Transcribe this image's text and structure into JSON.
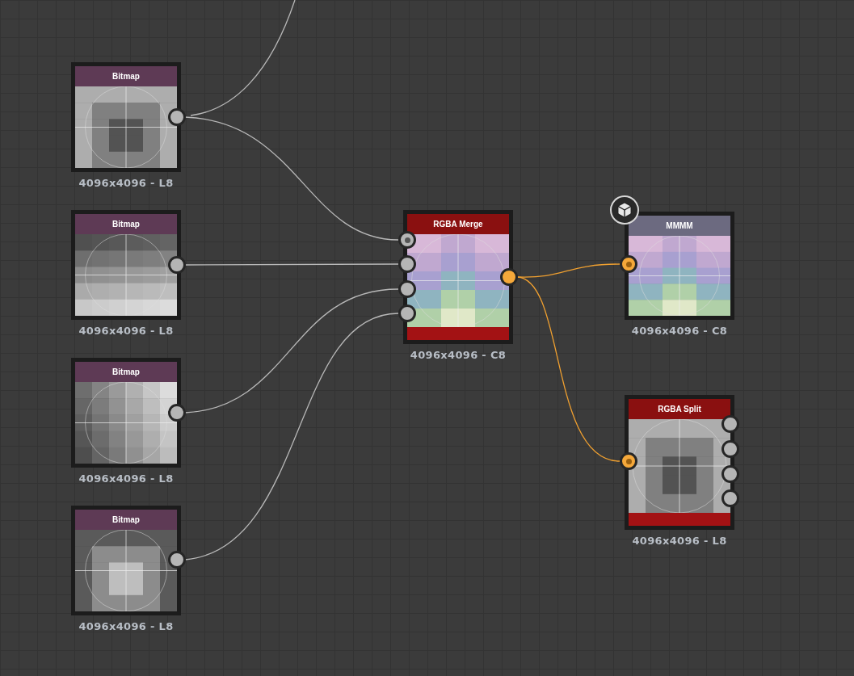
{
  "nodes": [
    {
      "title": "Bitmap",
      "kind": "bitmap",
      "color": "#5e3a55",
      "resolution": "4096x4096 - L8",
      "outputs": [
        {
          "kind": "grayscale",
          "dotted": false
        }
      ]
    },
    {
      "title": "Bitmap",
      "kind": "bitmap",
      "color": "#5e3a55",
      "resolution": "4096x4096 - L8",
      "outputs": [
        {
          "kind": "grayscale",
          "dotted": false
        }
      ]
    },
    {
      "title": "Bitmap",
      "kind": "bitmap",
      "color": "#5e3a55",
      "resolution": "4096x4096 - L8",
      "outputs": [
        {
          "kind": "grayscale",
          "dotted": false
        }
      ]
    },
    {
      "title": "Bitmap",
      "kind": "bitmap",
      "color": "#5e3a55",
      "resolution": "4096x4096 - L8",
      "outputs": [
        {
          "kind": "grayscale",
          "dotted": false
        }
      ]
    },
    {
      "title": "RGBA Merge",
      "kind": "filter",
      "color": "#8a1010",
      "resolution": "4096x4096 - C8",
      "inputs": [
        {
          "kind": "grayscale",
          "dotted": true
        },
        {
          "kind": "grayscale",
          "dotted": false
        },
        {
          "kind": "grayscale",
          "dotted": false
        },
        {
          "kind": "grayscale",
          "dotted": false
        }
      ],
      "outputs": [
        {
          "kind": "color",
          "dotted": false
        }
      ]
    },
    {
      "title": "MMMM",
      "kind": "output",
      "color": "#6c6a80",
      "resolution": "4096x4096 - C8",
      "inputs": [
        {
          "kind": "color",
          "dotted": true
        }
      ]
    },
    {
      "title": "RGBA Split",
      "kind": "filter",
      "color": "#8a1010",
      "resolution": "4096x4096 - L8",
      "inputs": [
        {
          "kind": "color",
          "dotted": true
        }
      ],
      "outputs": [
        {
          "kind": "grayscale",
          "dotted": false
        },
        {
          "kind": "grayscale",
          "dotted": false
        },
        {
          "kind": "grayscale",
          "dotted": false
        },
        {
          "kind": "grayscale",
          "dotted": false
        }
      ]
    }
  ]
}
